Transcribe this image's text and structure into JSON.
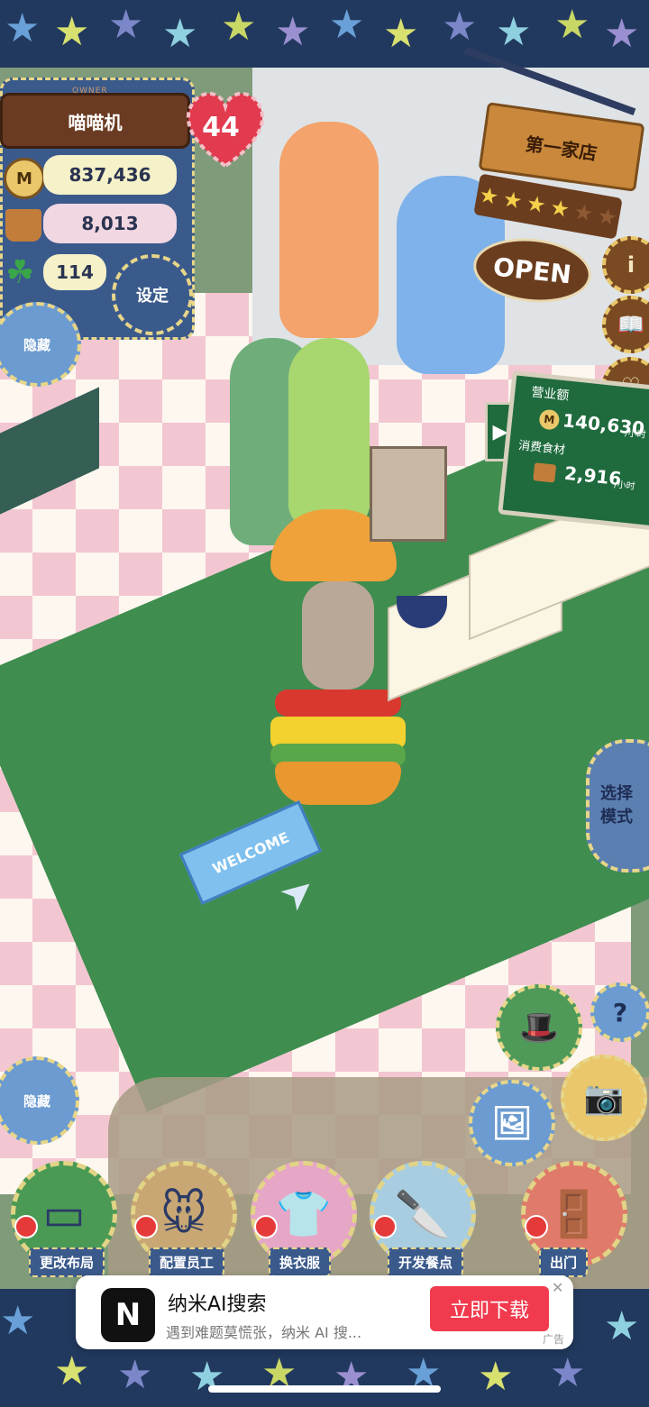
{
  "owner_panel": {
    "owner_tag": "OWNER",
    "name": "喵喵机",
    "coins": "837,436",
    "coin_glyph": "M",
    "ingredients": "8,013",
    "clovers": "114",
    "settings_label": "设定",
    "hide_label": "隐藏"
  },
  "level": {
    "value": "44",
    "color": "#e23a4e"
  },
  "shop_sign": {
    "name": "第一家店",
    "stars": 4,
    "max_stars": 6,
    "open_label": "OPEN"
  },
  "side_buttons": {
    "info": "i",
    "recipe": "📖",
    "heart": "♡"
  },
  "revenue_board": {
    "revenue_label": "营业额",
    "revenue_value": "140,630",
    "revenue_unit": "/小时",
    "consumed_label": "消费食材",
    "consumed_value": "2,916",
    "consumed_unit": "/小时",
    "arrow": "▶"
  },
  "select_mode": {
    "label": "选择模式"
  },
  "floor": {
    "welcome_mat": "WELCOME"
  },
  "left_hide": {
    "label": "隐藏"
  },
  "right_tools": {
    "help": "?",
    "camera": "📷",
    "hat": "🎩",
    "picture": "🖼"
  },
  "bottom_menu": [
    {
      "label": "更改布局",
      "icon": "table-icon",
      "glyph": "▭",
      "color": "#4a9a55"
    },
    {
      "label": "配置员工",
      "icon": "mouse-icon",
      "glyph": "🐭",
      "color": "#c9a774"
    },
    {
      "label": "换衣服",
      "icon": "shirt-icon",
      "glyph": "👕",
      "color": "#e6a6c6"
    },
    {
      "label": "开发餐点",
      "icon": "knife-icon",
      "glyph": "🔪",
      "color": "#a9cde0"
    },
    {
      "label": "出门",
      "icon": "door-icon",
      "glyph": "🚪",
      "color": "#e07b6b"
    }
  ],
  "ad": {
    "logo": "N",
    "title": "纳米AI搜索",
    "subtitle": "遇到难题莫慌张，纳米 AI 搜...",
    "button": "立即下载",
    "close": "✕",
    "tag": "广告"
  }
}
